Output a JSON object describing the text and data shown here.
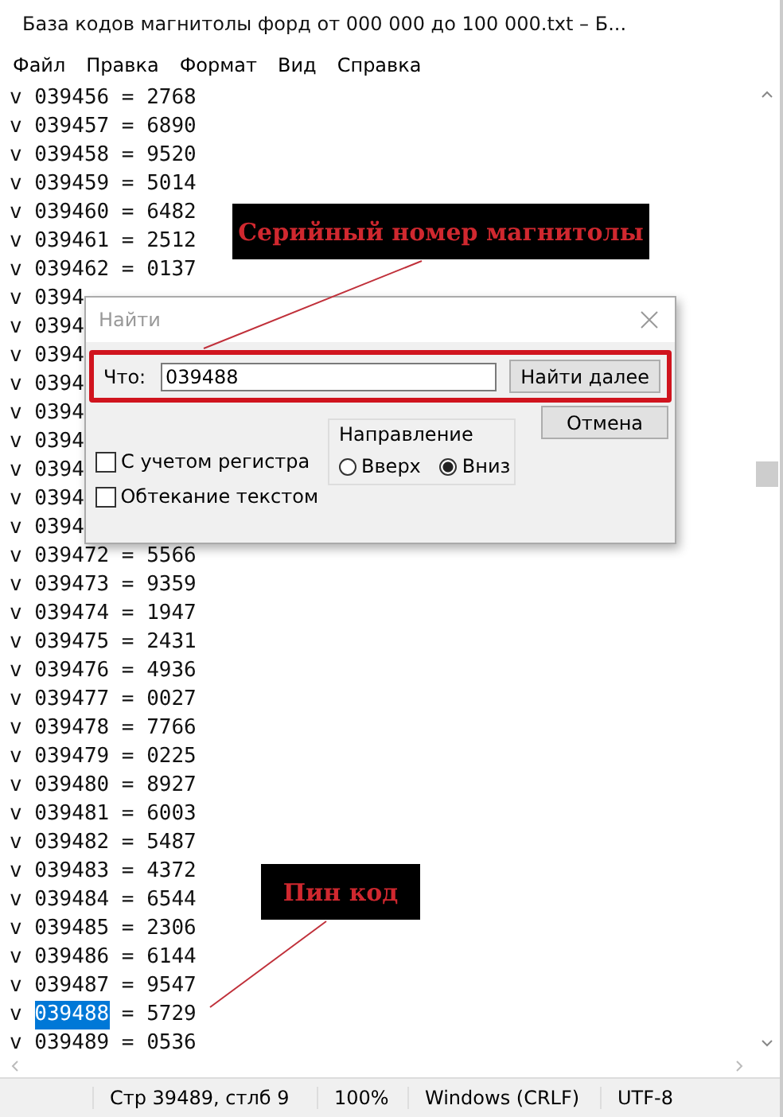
{
  "window": {
    "title": "База кодов магнитолы форд от 000 000 до 100 000.txt – Б..."
  },
  "menu": [
    "Файл",
    "Правка",
    "Формат",
    "Вид",
    "Справка"
  ],
  "lines": [
    {
      "marker": "v",
      "code": "039456",
      "rest": "= 2768",
      "selected": false
    },
    {
      "marker": "v",
      "code": "039457",
      "rest": "= 6890",
      "selected": false
    },
    {
      "marker": "v",
      "code": "039458",
      "rest": "= 9520",
      "selected": false
    },
    {
      "marker": "v",
      "code": "039459",
      "rest": "= 5014",
      "selected": false
    },
    {
      "marker": "v",
      "code": "039460",
      "rest": "= 6482",
      "selected": false
    },
    {
      "marker": "v",
      "code": "039461",
      "rest": "= 2512",
      "selected": false
    },
    {
      "marker": "v",
      "code": "039462",
      "rest": "= 0137",
      "selected": false
    },
    {
      "marker": "v",
      "code": "0394",
      "selected": false
    },
    {
      "marker": "v",
      "code": "0394",
      "selected": false
    },
    {
      "marker": "v",
      "code": "0394",
      "selected": false
    },
    {
      "marker": "v",
      "code": "0394",
      "selected": false
    },
    {
      "marker": "v",
      "code": "0394",
      "selected": false
    },
    {
      "marker": "v",
      "code": "0394",
      "selected": false
    },
    {
      "marker": "v",
      "code": "0394",
      "selected": false
    },
    {
      "marker": "v",
      "code": "0394",
      "selected": false
    },
    {
      "marker": "v",
      "code": "0394",
      "selected": false
    },
    {
      "marker": "v",
      "code": "039472",
      "rest": "= 5566",
      "selected": false
    },
    {
      "marker": "v",
      "code": "039473",
      "rest": "= 9359",
      "selected": false
    },
    {
      "marker": "v",
      "code": "039474",
      "rest": "= 1947",
      "selected": false
    },
    {
      "marker": "v",
      "code": "039475",
      "rest": "= 2431",
      "selected": false
    },
    {
      "marker": "v",
      "code": "039476",
      "rest": "= 4936",
      "selected": false
    },
    {
      "marker": "v",
      "code": "039477",
      "rest": "= 0027",
      "selected": false
    },
    {
      "marker": "v",
      "code": "039478",
      "rest": "= 7766",
      "selected": false
    },
    {
      "marker": "v",
      "code": "039479",
      "rest": "= 0225",
      "selected": false
    },
    {
      "marker": "v",
      "code": "039480",
      "rest": "= 8927",
      "selected": false
    },
    {
      "marker": "v",
      "code": "039481",
      "rest": "= 6003",
      "selected": false
    },
    {
      "marker": "v",
      "code": "039482",
      "rest": "= 5487",
      "selected": false
    },
    {
      "marker": "v",
      "code": "039483",
      "rest": "= 4372",
      "selected": false
    },
    {
      "marker": "v",
      "code": "039484",
      "rest": "= 6544",
      "selected": false
    },
    {
      "marker": "v",
      "code": "039485",
      "rest": "= 2306",
      "selected": false
    },
    {
      "marker": "v",
      "code": "039486",
      "rest": "= 6144",
      "selected": false
    },
    {
      "marker": "v",
      "code": "039487",
      "rest": "= 9547",
      "selected": false
    },
    {
      "marker": "v",
      "code": "039488",
      "rest": "= 5729",
      "selected": true
    },
    {
      "marker": "v",
      "code": "039489",
      "rest": "= 0536",
      "selected": false
    }
  ],
  "find_dialog": {
    "title": "Найти",
    "what_label": "Что:",
    "what_value": "039488",
    "find_next": "Найти далее",
    "cancel": "Отмена",
    "direction": {
      "label": "Направление",
      "options": [
        {
          "label": "Вверх",
          "selected": false
        },
        {
          "label": "Вниз",
          "selected": true
        }
      ]
    },
    "options": [
      {
        "label": "С учетом регистра",
        "checked": false
      },
      {
        "label": "Обтекание текстом",
        "checked": false
      }
    ]
  },
  "annotations": [
    {
      "text": "Серийный номер магнитолы"
    },
    {
      "text": "Пин код"
    }
  ],
  "status_bar": [
    "Стр 39489, стлб 9",
    "100%",
    "Windows (CRLF)",
    "UTF-8"
  ]
}
